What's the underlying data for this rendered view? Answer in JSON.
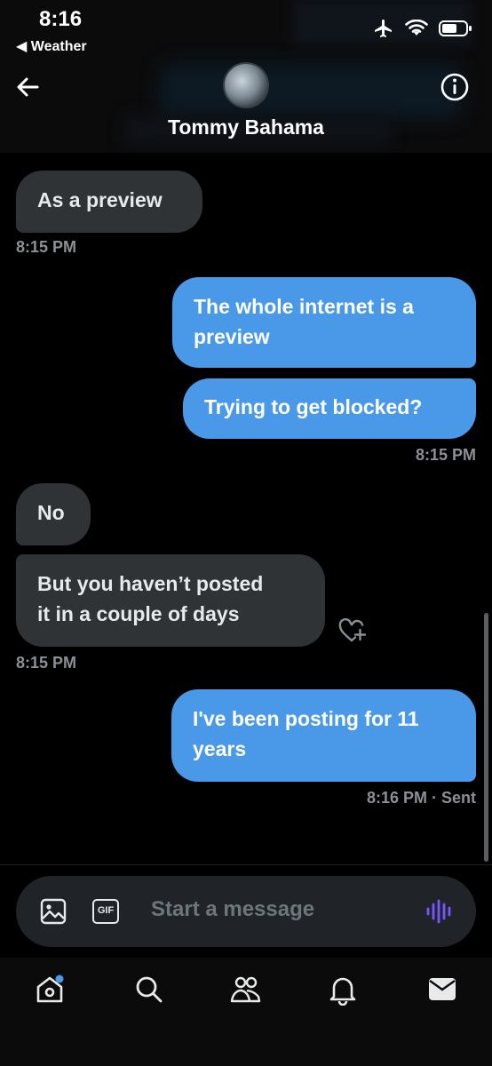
{
  "status_bar": {
    "time": "8:16",
    "back_label": "◀ Weather",
    "icons": [
      "airplane-icon",
      "wifi-icon",
      "battery-icon"
    ]
  },
  "header": {
    "contact_name": "Tommy Bahama",
    "back_icon": "arrow-left-icon",
    "info_icon": "info-icon"
  },
  "messages": [
    {
      "side": "in",
      "text": "As a preview"
    },
    {
      "timestamp": "8:15 PM"
    },
    {
      "side": "out",
      "text": "The whole internet is a preview"
    },
    {
      "side": "out",
      "text": "Trying to get blocked?"
    },
    {
      "timestamp": "8:15 PM"
    },
    {
      "side": "in",
      "text": "No"
    },
    {
      "side": "in",
      "text": "But you haven’t posted it in a couple of days"
    },
    {
      "timestamp": "8:15 PM"
    },
    {
      "side": "out",
      "text": "I've been posting for 11 years"
    },
    {
      "timestamp": "8:16 PM",
      "status": "Sent"
    }
  ],
  "bubbles": {
    "m1": "As a preview",
    "m1_time": "8:15 PM",
    "m2_line1": "The whole internet is a",
    "m2_line2": "preview",
    "m3": "Trying to get blocked?",
    "m3_time": "8:15 PM",
    "m4": "No",
    "m5_line1": "But you haven’t posted",
    "m5_line2": "it in a couple of days",
    "m5_time": "8:15 PM",
    "m6_line1": "I've been posting for 11",
    "m6_line2": "years",
    "m6_time": "8:16 PM",
    "m6_status": "· Sent"
  },
  "composer": {
    "placeholder": "Start a message",
    "gif_label": "GIF",
    "icons": [
      "image-icon",
      "gif-icon",
      "voice-icon"
    ]
  },
  "tab_bar": {
    "items": [
      "home-icon",
      "search-icon",
      "communities-icon",
      "notifications-icon",
      "messages-icon"
    ],
    "home_has_badge": true
  },
  "colors": {
    "outgoing_bubble": "#4a99e9",
    "incoming_bubble": "#2f3336",
    "background": "#000000",
    "voice_accent": "#7856ff"
  }
}
